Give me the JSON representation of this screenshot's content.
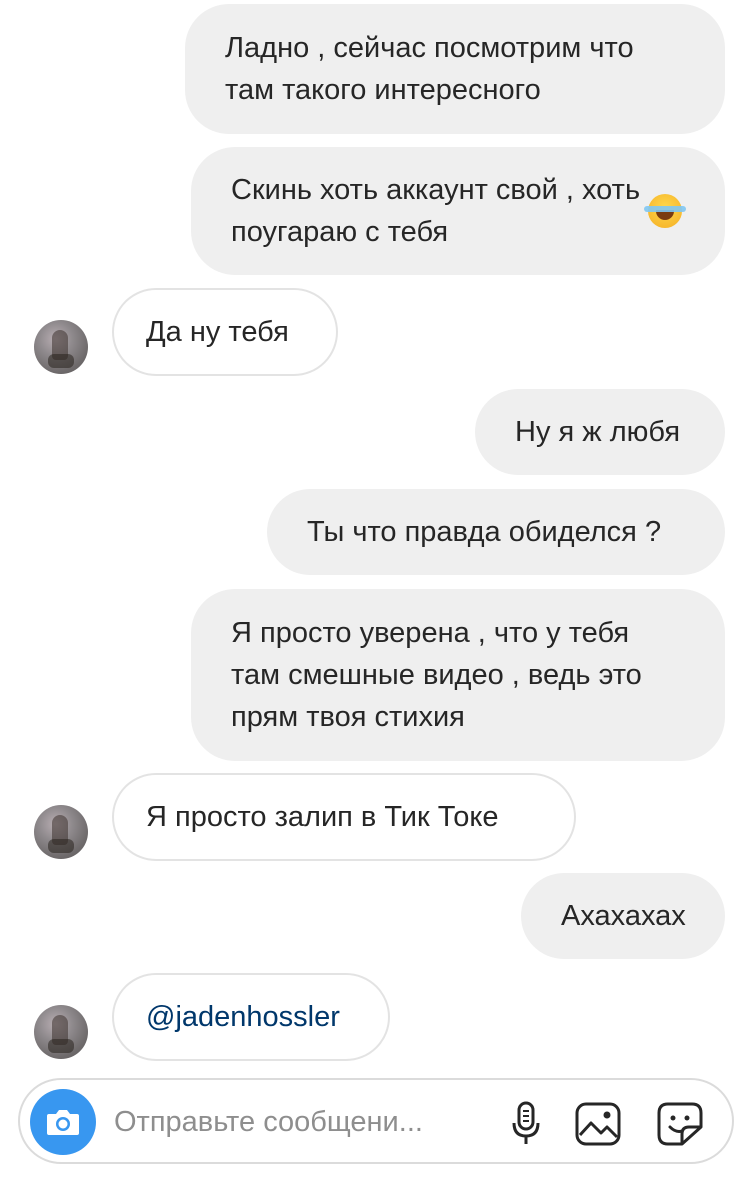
{
  "messages": [
    {
      "side": "out",
      "text": "Ладно , сейчас посмотрим что\nтам такого интересного"
    },
    {
      "side": "out",
      "text": "Скинь хоть аккаунт свой , хоть\nпоугараю с тебя",
      "emoji": "face-with-tears-of-joy"
    },
    {
      "side": "in",
      "text": "Да ну тебя"
    },
    {
      "side": "out",
      "text": "Ну я ж любя"
    },
    {
      "side": "out",
      "text": "Ты что правда обиделся ?"
    },
    {
      "side": "out",
      "text": "Я просто уверена , что у тебя\nтам смешные видео , ведь это\nпрям твоя стихия"
    },
    {
      "side": "in",
      "text": "Я просто залип в Тик Токе"
    },
    {
      "side": "out",
      "text": "Ахахахах"
    },
    {
      "side": "in",
      "text": "@jadenhossler",
      "mention": true
    }
  ],
  "composer": {
    "placeholder": "Отправьте сообщени...",
    "camera_icon": "camera-icon",
    "mic_icon": "microphone-icon",
    "gallery_icon": "gallery-icon",
    "sticker_icon": "sticker-icon"
  },
  "colors": {
    "outgoing_bubble": "#efefef",
    "incoming_border": "#e3e3e3",
    "camera_button": "#3897f0",
    "mention_text": "#00376b"
  }
}
